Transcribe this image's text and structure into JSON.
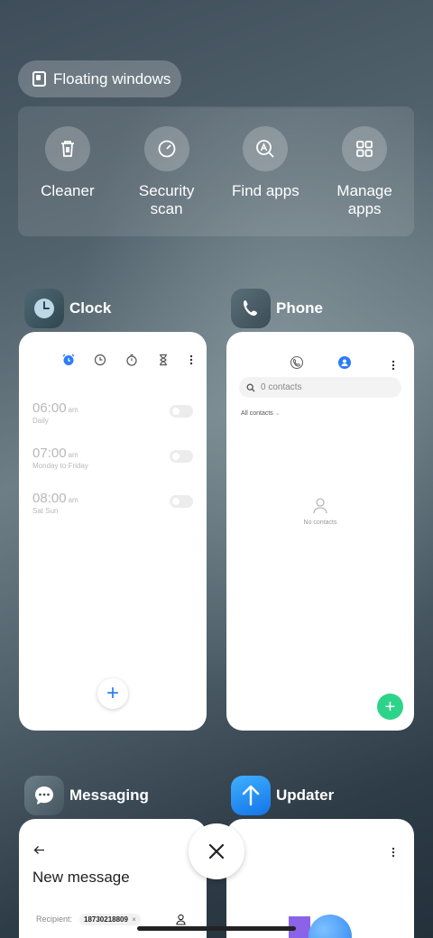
{
  "floating_windows": {
    "label": "Floating windows"
  },
  "tools": [
    {
      "label": "Cleaner",
      "icon": "trash-icon"
    },
    {
      "label": "Security scan",
      "icon": "security-scan-icon"
    },
    {
      "label": "Find apps",
      "icon": "find-apps-icon"
    },
    {
      "label": "Manage apps",
      "icon": "grid-icon"
    }
  ],
  "apps": {
    "clock": {
      "name": "Clock",
      "alarms": [
        {
          "time": "06:00",
          "ampm": "am",
          "repeat": "Daily"
        },
        {
          "time": "07:00",
          "ampm": "am",
          "repeat": "Monday to Friday"
        },
        {
          "time": "08:00",
          "ampm": "am",
          "repeat": "Sat Sun"
        }
      ],
      "add_symbol": "+"
    },
    "phone": {
      "name": "Phone",
      "search_placeholder": "0 contacts",
      "filter": "All contacts",
      "empty_text": "No contacts",
      "add_symbol": "+"
    },
    "messaging": {
      "name": "Messaging",
      "title": "New message",
      "recipient_label": "Recipient:",
      "recipient_value": "18730218809",
      "recipient_remove": "×"
    },
    "updater": {
      "name": "Updater"
    }
  },
  "colors": {
    "accent_blue": "#2d7cf6",
    "accent_green": "#2ed38a"
  }
}
